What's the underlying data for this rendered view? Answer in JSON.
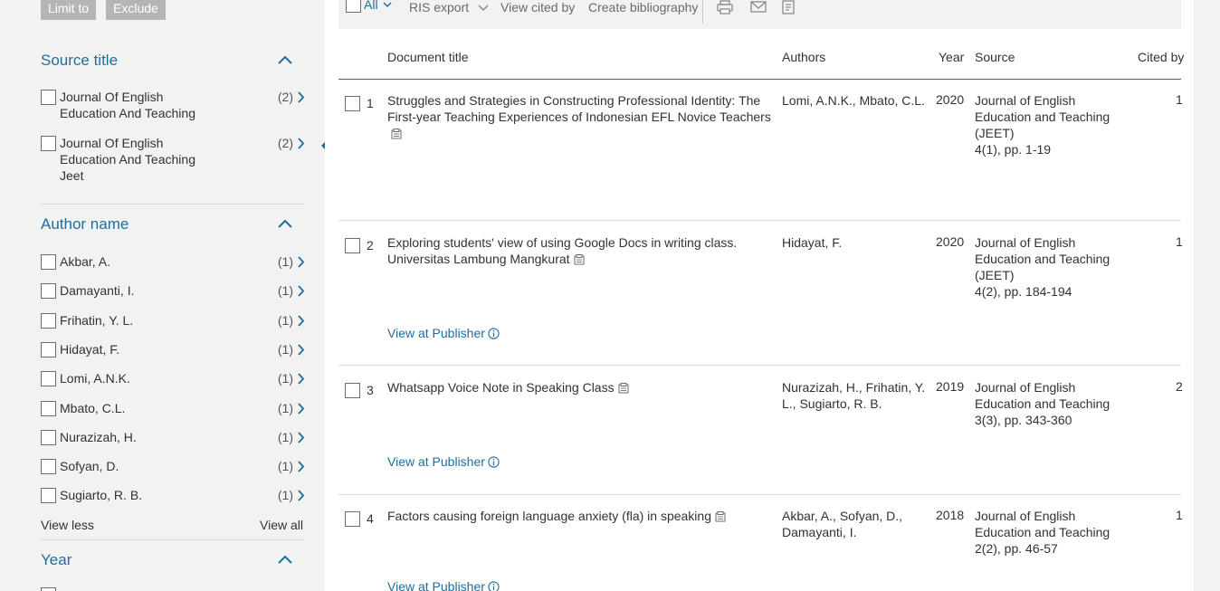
{
  "sidebar": {
    "limit_btn": "Limit to",
    "exclude_btn": "Exclude",
    "source_title": {
      "heading": "Source title",
      "items": [
        {
          "label": "Journal Of English Education And Teaching",
          "count": "(2)"
        },
        {
          "label": "Journal Of English Education And Teaching Jeet",
          "count": "(2)"
        }
      ]
    },
    "author_name": {
      "heading": "Author name",
      "items": [
        {
          "label": "Akbar, A.",
          "count": "(1)"
        },
        {
          "label": "Damayanti, I.",
          "count": "(1)"
        },
        {
          "label": "Frihatin, Y. L.",
          "count": "(1)"
        },
        {
          "label": "Hidayat, F.",
          "count": "(1)"
        },
        {
          "label": "Lomi, A.N.K.",
          "count": "(1)"
        },
        {
          "label": "Mbato, C.L.",
          "count": "(1)"
        },
        {
          "label": "Nurazizah, H.",
          "count": "(1)"
        },
        {
          "label": "Sofyan, D.",
          "count": "(1)"
        },
        {
          "label": "Sugiarto, R. B.",
          "count": "(1)"
        }
      ],
      "view_less": "View less",
      "view_all": "View all"
    },
    "year": {
      "heading": "Year"
    }
  },
  "toolbar": {
    "all": "All",
    "ris_export": "RIS export",
    "view_cited_by": "View cited by",
    "create_bibliography": "Create bibliography"
  },
  "columns": {
    "title": "Document title",
    "authors": "Authors",
    "year": "Year",
    "source": "Source",
    "cited_by": "Cited by"
  },
  "results": [
    {
      "num": "1",
      "title": "Struggles and Strategies in Constructing Professional Identity: The First-year Teaching Experiences of Indonesian EFL Novice Teachers",
      "authors": "Lomi, A.N.K., Mbato, C.L.",
      "year": "2020",
      "source": "Journal of English Education and Teaching (JEET)",
      "pages": "4(1), pp. 1-19",
      "cited": "1"
    },
    {
      "num": "2",
      "title": "Exploring students' view of using Google Docs in writing class. Universitas Lambung Mangkurat",
      "authors": "Hidayat, F.",
      "year": "2020",
      "source": "Journal of English Education and Teaching (JEET)",
      "pages": "4(2), pp. 184-194",
      "cited": "1",
      "publisher_link": "View at Publisher"
    },
    {
      "num": "3",
      "title": "Whatsapp Voice Note in Speaking Class",
      "authors": "Nurazizah, H., Frihatin, Y. L., Sugiarto, R. B.",
      "year": "2019",
      "source": "Journal of English Education and Teaching",
      "pages": "3(3), pp. 343-360",
      "cited": "2",
      "publisher_link": "View at Publisher"
    },
    {
      "num": "4",
      "title": "Factors causing foreign language anxiety (fla) in speaking",
      "authors": "Akbar, A., Sofyan, D., Damayanti, I.",
      "year": "2018",
      "source": "Journal of English Education and Teaching",
      "pages": "2(2), pp. 46-57",
      "cited": "1",
      "publisher_link": "View at Publisher"
    }
  ]
}
